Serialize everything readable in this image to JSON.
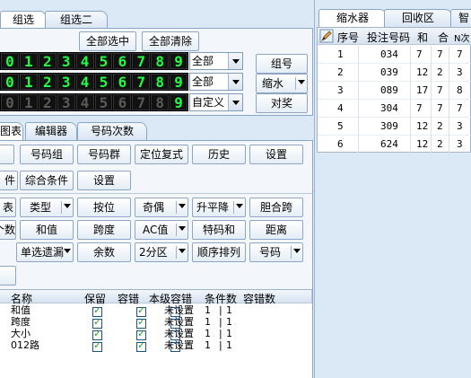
{
  "top_tabs": [
    "组选",
    "组选二"
  ],
  "select_buttons": {
    "select_all": "全部选中",
    "clear_all": "全部清除"
  },
  "digit_rows": [
    {
      "digits": [
        "0",
        "1",
        "2",
        "3",
        "4",
        "5",
        "6",
        "7",
        "8",
        "9"
      ],
      "dim": [],
      "select": "全部"
    },
    {
      "digits": [
        "0",
        "1",
        "2",
        "3",
        "4",
        "5",
        "6",
        "7",
        "8",
        "9"
      ],
      "dim": [],
      "select": "全部"
    },
    {
      "digits": [
        "0",
        "1",
        "2",
        "3",
        "4",
        "5",
        "6",
        "7",
        "8",
        "9"
      ],
      "dim": [
        "0",
        "1",
        "2",
        "3",
        "4",
        "5",
        "6",
        "7",
        "8"
      ],
      "select": "自定义"
    }
  ],
  "side_buttons": {
    "zuhao": "组号",
    "suoshui": "缩水",
    "duijiang": "对奖"
  },
  "mid_tabs": [
    "图表",
    "编辑器",
    "号码次数"
  ],
  "tool_row1": [
    "号码组",
    "号码群",
    "定位复式",
    "历史",
    "设置"
  ],
  "tool_row2": {
    "left_fragment": "件",
    "compound": "综合条件",
    "settings": "设置"
  },
  "cond_row1": {
    "frag": "表",
    "type": "类型",
    "position": "按位",
    "oddeven": "奇偶",
    "rise": "升平降",
    "courage": "胆合跨"
  },
  "cond_row2": {
    "frag": "个数",
    "sum": "和值",
    "span": "跨度",
    "ac": "AC值",
    "special": "特码和",
    "distance": "距离"
  },
  "cond_row3": {
    "miss": "单选遗漏",
    "rem": "余数",
    "twozone": "2分区",
    "seq": "顺序排列",
    "number": "号码"
  },
  "cond_table": {
    "headers": [
      "名称",
      "保留",
      "容错",
      "本级容错",
      "条件数",
      "容错数"
    ],
    "rows": [
      {
        "name": "和值",
        "keep": true,
        "tol": true,
        "level": "未设置",
        "count": "1",
        "errcount": "1"
      },
      {
        "name": "跨度",
        "keep": true,
        "tol": true,
        "level": "未设置",
        "count": "1",
        "errcount": "1"
      },
      {
        "name": "大小",
        "keep": true,
        "tol": true,
        "level": "未设置",
        "count": "1",
        "errcount": "1"
      },
      {
        "name": "012路",
        "keep": true,
        "tol": true,
        "level": "未设置",
        "count": "1",
        "errcount": "1"
      }
    ]
  },
  "right_tabs": [
    "缩水器",
    "回收区",
    "智"
  ],
  "right_table": {
    "headers": [
      "序号",
      "投注号码",
      "和",
      "合",
      "N次"
    ],
    "rows": [
      {
        "idx": "1",
        "num": "034",
        "he": "7",
        "hh": "7",
        "n": "7"
      },
      {
        "idx": "2",
        "num": "039",
        "he": "12",
        "hh": "2",
        "n": "3"
      },
      {
        "idx": "3",
        "num": "089",
        "he": "17",
        "hh": "7",
        "n": "8"
      },
      {
        "idx": "4",
        "num": "304",
        "he": "7",
        "hh": "7",
        "n": "7"
      },
      {
        "idx": "5",
        "num": "309",
        "he": "12",
        "hh": "2",
        "n": "3"
      },
      {
        "idx": "6",
        "num": "624",
        "he": "12",
        "hh": "2",
        "n": "3"
      }
    ]
  }
}
